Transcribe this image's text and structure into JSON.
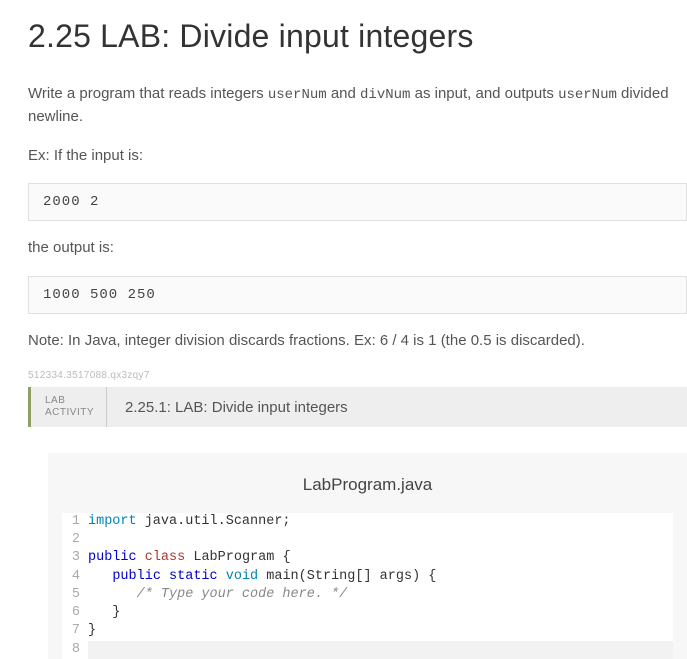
{
  "title": "2.25 LAB: Divide input integers",
  "intro_parts": {
    "a": "Write a program that reads integers ",
    "b": "userNum",
    "c": " and ",
    "d": "divNum",
    "e": " as input, and outputs ",
    "f": "userNum",
    "g": " divided newline."
  },
  "ex_label": "Ex: If the input is:",
  "input_example": "2000 2",
  "output_label": "the output is:",
  "output_example": "1000 500 250",
  "note": "Note: In Java, integer division discards fractions. Ex: 6 / 4 is 1 (the 0.5 is discarded).",
  "small_id": "512334.3517088.qx3zqy7",
  "activity": {
    "badge_line1": "LAB",
    "badge_line2": "ACTIVITY",
    "title": "2.25.1: LAB: Divide input integers"
  },
  "editor": {
    "filename": "LabProgram.java",
    "lines": [
      {
        "n": "1",
        "tokens": [
          {
            "cls": "kw-import",
            "t": "import"
          },
          {
            "cls": "",
            "t": " java.util.Scanner;"
          }
        ]
      },
      {
        "n": "2",
        "tokens": [
          {
            "cls": "",
            "t": ""
          }
        ]
      },
      {
        "n": "3",
        "tokens": [
          {
            "cls": "kw-blue",
            "t": "public"
          },
          {
            "cls": "",
            "t": " "
          },
          {
            "cls": "kw-red",
            "t": "class"
          },
          {
            "cls": "",
            "t": " "
          },
          {
            "cls": "ident",
            "t": "LabProgram"
          },
          {
            "cls": "",
            "t": " {"
          }
        ]
      },
      {
        "n": "4",
        "tokens": [
          {
            "cls": "",
            "t": "   "
          },
          {
            "cls": "kw-blue",
            "t": "public"
          },
          {
            "cls": "",
            "t": " "
          },
          {
            "cls": "kw-blue",
            "t": "static"
          },
          {
            "cls": "",
            "t": " "
          },
          {
            "cls": "kw-type",
            "t": "void"
          },
          {
            "cls": "",
            "t": " main(String[] args) {"
          }
        ]
      },
      {
        "n": "5",
        "tokens": [
          {
            "cls": "",
            "t": "      "
          },
          {
            "cls": "comment",
            "t": "/* Type your code here. */"
          }
        ]
      },
      {
        "n": "6",
        "tokens": [
          {
            "cls": "",
            "t": "   }"
          }
        ]
      },
      {
        "n": "7",
        "tokens": [
          {
            "cls": "",
            "t": "}"
          }
        ]
      },
      {
        "n": "8",
        "tokens": [
          {
            "cls": "",
            "t": ""
          }
        ],
        "cursor": true
      }
    ]
  }
}
